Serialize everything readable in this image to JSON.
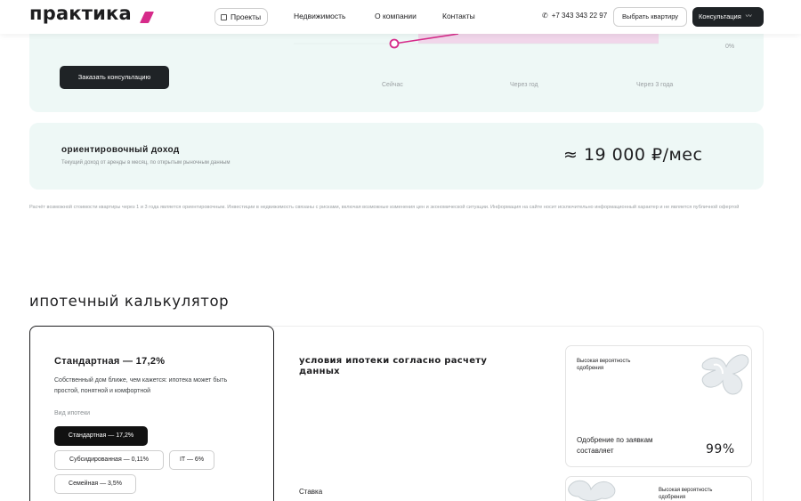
{
  "header": {
    "logo": "практика",
    "nav": {
      "projects": "Проекты",
      "realty": "Недвижимость",
      "about": "О компании",
      "contacts": "Контакты"
    },
    "phone": "+7 343 343 22 97",
    "choose_button": "Выбрать квартиру",
    "consult_button": "Консультация",
    "accent_color": "#d62b8a"
  },
  "forecast": {
    "order_button": "Заказать консультацию",
    "x_ticks": [
      "Сейчас",
      "Через год",
      "Через 3 года"
    ],
    "y_tick": "0%",
    "line_color": "#d62b8a"
  },
  "income": {
    "title": "ориентировочный доход",
    "subtitle": "Текущий доход от аренды в месяц, по открытым рыночным данным",
    "value": "≈ 19 000 ₽/мес"
  },
  "disclaimer": "Расчёт возможной стоимости квартиры через 1 и 3 года является ориентировочным. Инвестиции в недвижимость связаны с рисками, включая возможные изменения цен и экономической ситуации. Информация на сайте носит исключительно информационный характер и не является публичной офертой",
  "calculator": {
    "section_title": "ипотечный калькулятор",
    "selected_title": "Стандартная — 17,2%",
    "selected_desc": "Собственный дом ближе, чем кажется: ипотека может быть простой, понятной и комфортной",
    "type_label": "Вид ипотеки",
    "types": {
      "standard": "Стандартная — 17,2%",
      "subsidized": "Субсидированная — 0,11%",
      "it": "IT — 6%",
      "family": "Семейная — 3,5%"
    },
    "conditions_title": "условия ипотеки согласно расчету данных",
    "rate_label": "Ставка",
    "approval_card": {
      "label": "Высокая вероятность одобрения",
      "approval_text": "Одобрение по заявкам составляет",
      "percent": "99%"
    },
    "approval_card_2": {
      "label": "Высокая вероятность одобрения"
    }
  }
}
